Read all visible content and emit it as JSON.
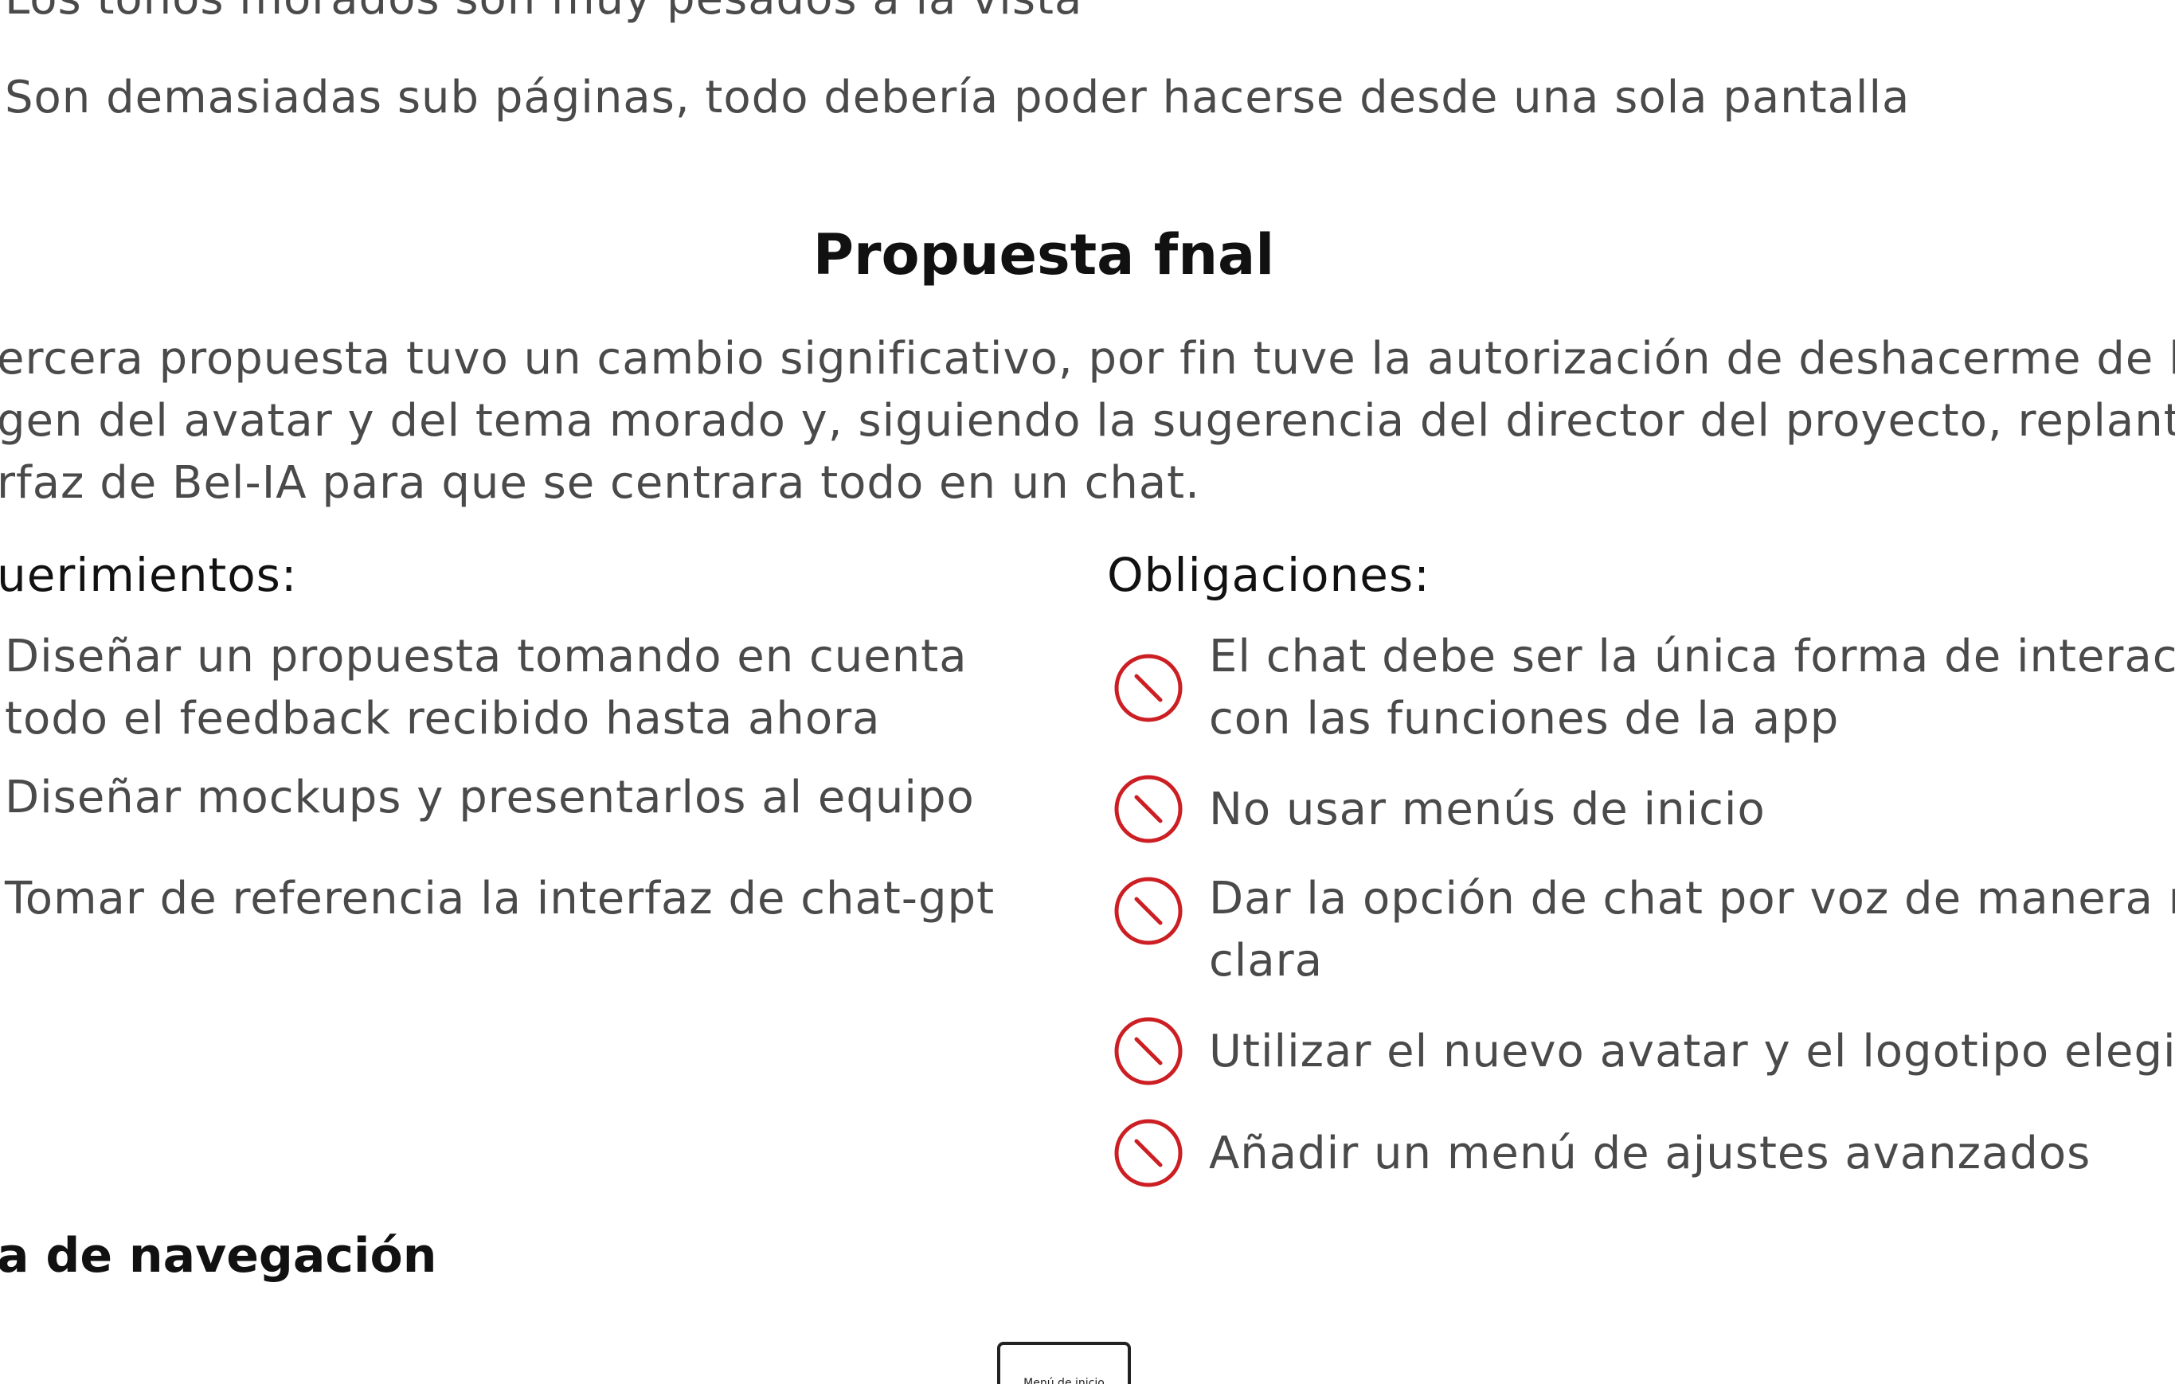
{
  "feedback": {
    "line_partial": "Los tonos morados son muy pesados a la vista",
    "line_full": "Son demasiadas sub páginas, todo debería poder hacerse desde una sola pantalla"
  },
  "section": {
    "title": "Propuesta fnal",
    "intro_lines": [
      "ercera propuesta tuvo un cambio significativo, por fin tuve la autorización de deshacerme de la",
      "gen del avatar y del tema morado y, siguiendo la sugerencia del director del proyecto, replanteé",
      "rfaz de Bel-IA para que se centrara todo en un chat."
    ]
  },
  "requirements": {
    "heading": "uerimientos:",
    "items": [
      [
        "Diseñar un propuesta tomando en cuenta",
        "todo el feedback recibido hasta ahora"
      ],
      [
        "Diseñar mockups y presentarlos al equipo"
      ],
      [
        "Tomar de referencia la interfaz de chat-gpt"
      ]
    ]
  },
  "obligations": {
    "heading": "Obligaciones:",
    "icon": "ban-icon",
    "icon_color": "#cc1f24",
    "items": [
      [
        "El chat debe ser la única forma de interacc",
        "con las funciones de la app"
      ],
      [
        "No usar menús de inicio"
      ],
      [
        "Dar la opción de chat por voz de manera m",
        "clara"
      ],
      [
        "Utilizar el nuevo avatar y el logotipo elegid"
      ],
      [
        "Añadir un menú de ajustes avanzados"
      ]
    ]
  },
  "navigation": {
    "heading": "a de navegación",
    "node_label": "Menú de inicio"
  }
}
